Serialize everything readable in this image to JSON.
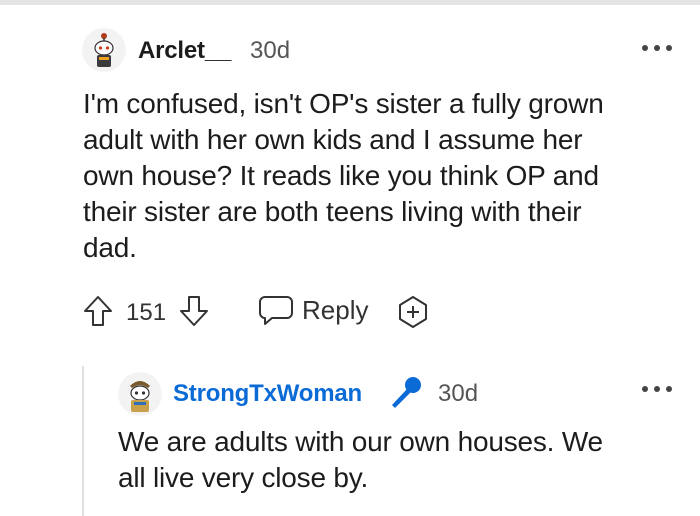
{
  "comment": {
    "author": "Arclet__",
    "time": "30d",
    "body": "I'm confused, isn't OP's sister a fully grown\nadult with her own kids and I assume her\nown house? It reads like you think OP and\ntheir sister are both teens living with their\ndad.",
    "upvote_count": "151",
    "reply_label": "Reply"
  },
  "reply": {
    "author": "StrongTxWoman",
    "time": "30d",
    "body": "We are adults with our own houses. We\nall live very close by."
  },
  "icons": {
    "upvote": "arrow-up-icon",
    "downvote": "arrow-down-icon",
    "reply": "speech-bubble-icon",
    "award": "plus-award-icon",
    "more": "more-dots-icon",
    "mic": "microphone-icon"
  },
  "colors": {
    "username_op": "#1c1c1c",
    "username_reply": "#0a6bd6",
    "mic": "#0a6bd6",
    "text": "#1c1c1c",
    "meta": "#555555"
  }
}
